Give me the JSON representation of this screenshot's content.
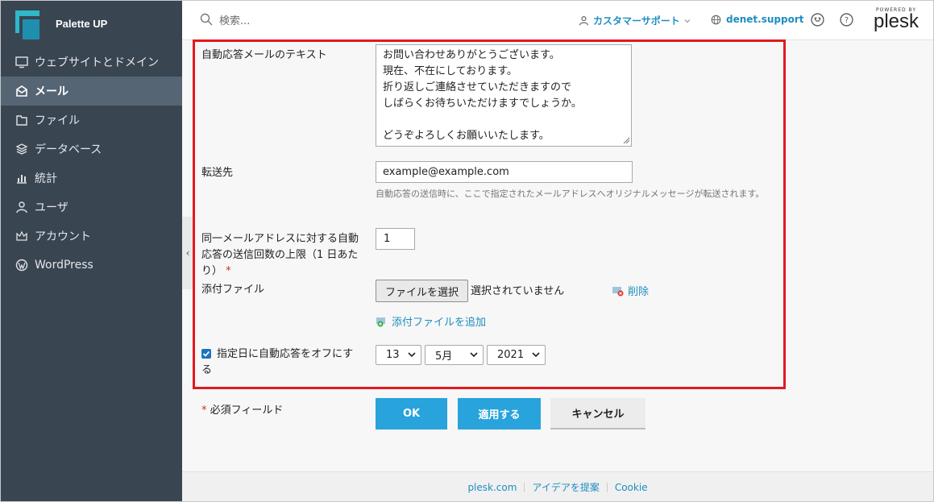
{
  "sidebar": {
    "brand": "Palette UP",
    "items": [
      {
        "label": "ウェブサイトとドメイン",
        "icon": "monitor-icon"
      },
      {
        "label": "メール",
        "icon": "mail-icon",
        "active": true
      },
      {
        "label": "ファイル",
        "icon": "folder-icon"
      },
      {
        "label": "データベース",
        "icon": "database-icon"
      },
      {
        "label": "統計",
        "icon": "bar-chart-icon"
      },
      {
        "label": "ユーザ",
        "icon": "user-icon"
      },
      {
        "label": "アカウント",
        "icon": "crown-icon"
      },
      {
        "label": "WordPress",
        "icon": "wordpress-icon"
      }
    ]
  },
  "header": {
    "search_placeholder": "検索...",
    "support_label": "カスタマーサポート",
    "domain_label": "denet.support",
    "powered_by": "POWERED BY",
    "plesk": "plesk"
  },
  "form": {
    "autoreply_label": "自動応答メールのテキスト",
    "autoreply_lines": [
      "お問い合わせありがとうございます。",
      "現在、不在にしております。",
      "折り返しご連絡させていただきますので",
      "しばらくお待ちいただけますでしょうか。",
      "",
      "どうぞよろしくお願いいたします。"
    ],
    "forward_label": "転送先",
    "forward_value": "example@example.com",
    "forward_hint": "自動応答の送信時に、ここで指定されたメールアドレスへオリジナルメッセージが転送されます。",
    "limit_label": "同一メールアドレスに対する自動応答の送信回数の上限（1 日あたり）",
    "limit_required": "*",
    "limit_value": "1",
    "attach_label": "添付ファイル",
    "choose_file": "ファイルを選択",
    "no_file": "選択されていません",
    "delete_label": "削除",
    "add_attach": "添付ファイルを追加",
    "disable_label": "指定日に自動応答をオフにする",
    "disable_checked": true,
    "day": "13",
    "month": "5月",
    "year": "2021",
    "required_note": "必須フィールド",
    "required_star": "*",
    "ok": "OK",
    "apply": "適用する",
    "cancel": "キャンセル"
  },
  "footer": {
    "links": [
      "plesk.com",
      "アイデアを提案",
      "Cookie"
    ]
  },
  "colors": {
    "sidebar_bg": "#3a4552",
    "active_bg": "#566574",
    "accent": "#28a3dc",
    "link": "#1e8ec0",
    "highlight_border": "#e3191e"
  }
}
